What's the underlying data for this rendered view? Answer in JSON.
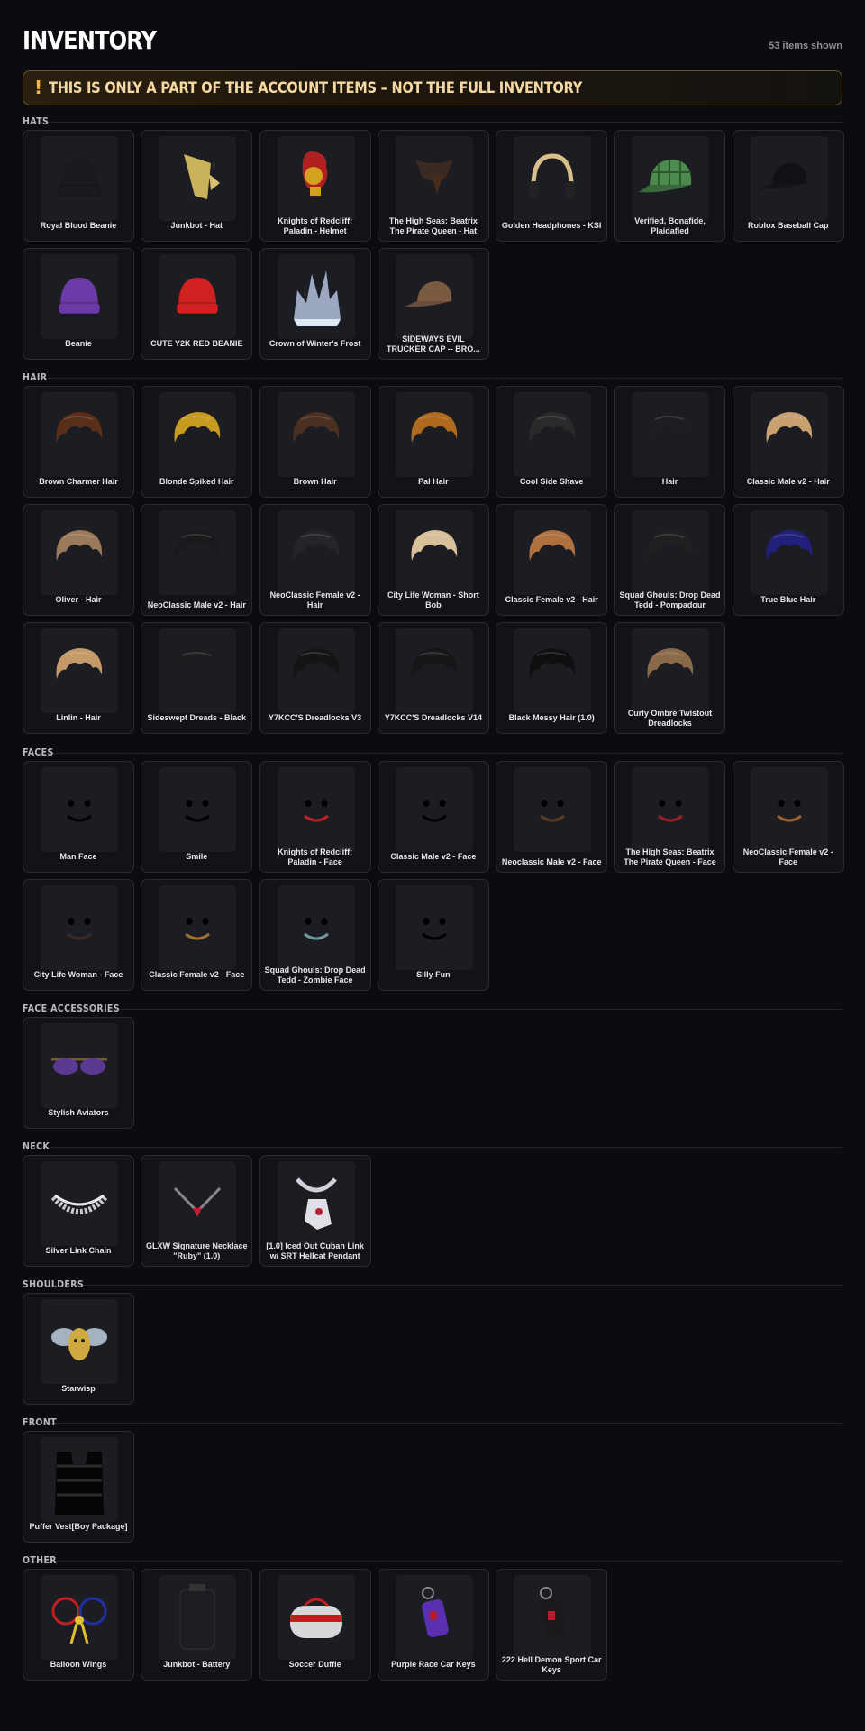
{
  "header": {
    "title": "INVENTORY",
    "count": "53 items shown"
  },
  "warning": {
    "icon": "exclamation-icon",
    "icon_glyph": "!",
    "text": "THIS IS ONLY A PART OF THE ACCOUNT ITEMS – NOT THE FULL INVENTORY"
  },
  "colors": {
    "background": "#0b0b10",
    "card": "#121218",
    "accent": "#f3b24a",
    "warning_text": "#f6d9a2"
  },
  "sections": [
    {
      "id": "hats",
      "title": "HATS",
      "items": [
        {
          "name": "Royal Blood Beanie",
          "icon": "beanie-icon",
          "color": "#1a1a1e"
        },
        {
          "name": "Junkbot - Hat",
          "icon": "cone-hat-icon",
          "color": "#c9b25a"
        },
        {
          "name": "Knights of Redcliff: Paladin - Helmet",
          "icon": "helmet-icon",
          "color": "#b02020"
        },
        {
          "name": "The High Seas: Beatrix The Pirate Queen - Hat",
          "icon": "pirate-hat-icon",
          "color": "#3a2a22"
        },
        {
          "name": "Golden Headphones - KSI",
          "icon": "headphones-icon",
          "color": "#d9c08a"
        },
        {
          "name": "Verified, Bonafide, Plaidafied",
          "icon": "plaid-cap-icon",
          "color": "#4d8a4d"
        },
        {
          "name": "Roblox Baseball Cap",
          "icon": "cap-icon",
          "color": "#111115"
        },
        {
          "name": "Beanie",
          "icon": "beanie-icon",
          "color": "#6b3aa8"
        },
        {
          "name": "CUTE Y2K RED BEANIE",
          "icon": "beanie-icon",
          "color": "#d02020"
        },
        {
          "name": "Crown of Winter's Frost",
          "icon": "crown-icon",
          "color": "#aab8d0"
        },
        {
          "name": "SIDEWAYS EVIL TRUCKER CAP -- BRO...",
          "icon": "cap-icon",
          "color": "#7a5a40"
        }
      ]
    },
    {
      "id": "hair",
      "title": "HAIR",
      "items": [
        {
          "name": "Brown Charmer Hair",
          "icon": "hair-icon",
          "color": "#5a2f18"
        },
        {
          "name": "Blonde Spiked Hair",
          "icon": "hair-icon",
          "color": "#c79a20"
        },
        {
          "name": "Brown Hair",
          "icon": "hair-icon",
          "color": "#4a3020"
        },
        {
          "name": "Pal Hair",
          "icon": "hair-icon",
          "color": "#b06a20"
        },
        {
          "name": "Cool Side Shave",
          "icon": "hair-icon",
          "color": "#2a2a2a"
        },
        {
          "name": "Hair",
          "icon": "hair-icon",
          "color": "#1e1e22"
        },
        {
          "name": "Classic Male v2 - Hair",
          "icon": "hair-icon",
          "color": "#c9a070"
        },
        {
          "name": "Oliver - Hair",
          "icon": "hair-icon",
          "color": "#9a7a5a"
        },
        {
          "name": "NeoClassic Male v2 - Hair",
          "icon": "hair-icon",
          "color": "#1a1a1c"
        },
        {
          "name": "NeoClassic Female v2 - Hair",
          "icon": "hair-icon",
          "color": "#26242a"
        },
        {
          "name": "City Life Woman - Short Bob",
          "icon": "hair-icon",
          "color": "#d8c09a"
        },
        {
          "name": "Classic Female v2 - Hair",
          "icon": "hair-icon",
          "color": "#b07040"
        },
        {
          "name": "Squad Ghouls: Drop Dead Tedd - Pompadour",
          "icon": "hair-icon",
          "color": "#202020"
        },
        {
          "name": "True Blue Hair",
          "icon": "hair-icon",
          "color": "#22207a"
        },
        {
          "name": "Linlin - Hair",
          "icon": "hair-icon",
          "color": "#c49a68"
        },
        {
          "name": "Sideswept Dreads - Black",
          "icon": "hair-icon",
          "color": "#1c1c1e"
        },
        {
          "name": "Y7KCC'S Dreadlocks V3",
          "icon": "hair-icon",
          "color": "#141414"
        },
        {
          "name": "Y7KCC'S Dreadlocks V14",
          "icon": "hair-icon",
          "color": "#161616"
        },
        {
          "name": "Black Messy Hair (1.0)",
          "icon": "hair-icon",
          "color": "#0f0f10"
        },
        {
          "name": "Curly Ombre Twistout Dreadlocks",
          "icon": "hair-icon",
          "color": "#8a6a48"
        }
      ]
    },
    {
      "id": "faces",
      "title": "FACES",
      "items": [
        {
          "name": "Man Face",
          "icon": "face-icon",
          "color": "#000000"
        },
        {
          "name": "Smile",
          "icon": "face-icon",
          "color": "#000000"
        },
        {
          "name": "Knights of Redcliff: Paladin - Face",
          "icon": "face-icon",
          "color": "#c02020"
        },
        {
          "name": "Classic Male v2 - Face",
          "icon": "face-icon",
          "color": "#000000"
        },
        {
          "name": "Neoclassic Male v2 - Face",
          "icon": "face-icon",
          "color": "#5a3a20"
        },
        {
          "name": "The High Seas: Beatrix The Pirate Queen - Face",
          "icon": "face-icon",
          "color": "#a02020"
        },
        {
          "name": "NeoClassic Female v2 - Face",
          "icon": "face-icon",
          "color": "#a0602a"
        },
        {
          "name": "City Life Woman - Face",
          "icon": "face-icon",
          "color": "#3a2a2a"
        },
        {
          "name": "Classic Female v2 - Face",
          "icon": "face-icon",
          "color": "#a07030"
        },
        {
          "name": "Squad Ghouls: Drop Dead Tedd - Zombie Face",
          "icon": "face-icon",
          "color": "#6f9a98"
        },
        {
          "name": "Silly Fun",
          "icon": "face-icon",
          "color": "#000000"
        }
      ]
    },
    {
      "id": "face-accessories",
      "title": "FACE ACCESSORIES",
      "items": [
        {
          "name": "Stylish Aviators",
          "icon": "sunglasses-icon",
          "color": "#5a3a90"
        }
      ]
    },
    {
      "id": "neck",
      "title": "NECK",
      "items": [
        {
          "name": "Silver Link Chain",
          "icon": "chain-icon",
          "color": "#c8c8cc"
        },
        {
          "name": "GLXW Signature Necklace \"Ruby\" (1.0)",
          "icon": "necklace-icon",
          "color": "#c02030"
        },
        {
          "name": "[1.0] Iced Out Cuban Link w/ SRT Hellcat Pendant",
          "icon": "pendant-icon",
          "color": "#d0d0d8"
        }
      ]
    },
    {
      "id": "shoulders",
      "title": "SHOULDERS",
      "items": [
        {
          "name": "Starwisp",
          "icon": "bee-icon",
          "color": "#d0a840"
        }
      ]
    },
    {
      "id": "front",
      "title": "FRONT",
      "items": [
        {
          "name": "Puffer Vest[Boy Package]",
          "icon": "vest-icon",
          "color": "#141416"
        }
      ]
    },
    {
      "id": "other",
      "title": "OTHER",
      "items": [
        {
          "name": "Balloon Wings",
          "icon": "bow-icon",
          "color": "#c02020"
        },
        {
          "name": "Junkbot - Battery",
          "icon": "battery-icon",
          "color": "#1e1e22"
        },
        {
          "name": "Soccer Duffle",
          "icon": "duffle-icon",
          "color": "#d8d8da"
        },
        {
          "name": "Purple Race Car Keys",
          "icon": "car-keys-icon",
          "color": "#5a30b0"
        },
        {
          "name": "222 Hell Demon Sport Car Keys",
          "icon": "car-keys-icon",
          "color": "#1a1a1c"
        }
      ]
    }
  ]
}
